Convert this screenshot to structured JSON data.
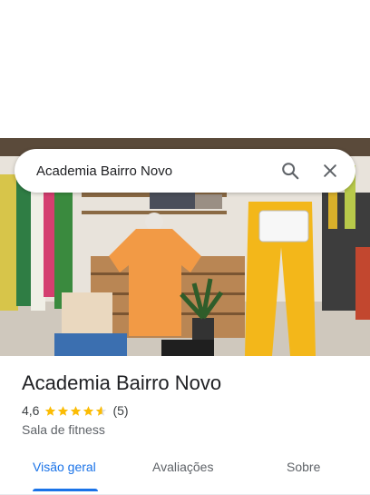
{
  "search": {
    "query": "Academia Bairro Novo"
  },
  "place": {
    "name": "Academia Bairro Novo",
    "rating": "4,6",
    "rating_value": 4.6,
    "review_count": "(5)",
    "category": "Sala de fitness"
  },
  "tabs": [
    {
      "label": "Visão geral",
      "active": true
    },
    {
      "label": "Avaliações",
      "active": false
    },
    {
      "label": "Sobre",
      "active": false
    }
  ],
  "colors": {
    "accent": "#1a73e8",
    "star": "#fbbc04",
    "text": "#202124",
    "muted": "#5f6368"
  },
  "icons": {
    "search": "search-icon",
    "close": "close-icon",
    "star": "star-icon"
  }
}
